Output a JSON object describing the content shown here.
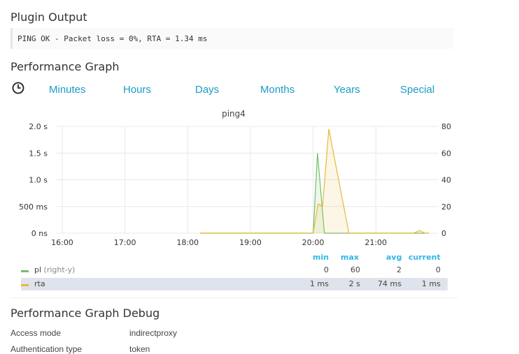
{
  "plugin_output": {
    "title": "Plugin Output",
    "text": "PING OK - Packet loss = 0%, RTA = 1.34 ms"
  },
  "performance_graph": {
    "title": "Performance Graph",
    "icon": "clock-icon",
    "ranges": [
      "Minutes",
      "Hours",
      "Days",
      "Months",
      "Years",
      "Special"
    ],
    "link_color": "#1a9bc7"
  },
  "chart_data": {
    "type": "area",
    "title": "ping4",
    "x_ticks": [
      "16:00",
      "17:00",
      "18:00",
      "19:00",
      "20:00",
      "21:00"
    ],
    "y_left_ticks": [
      "0 ns",
      "500 ms",
      "1.0 s",
      "1.5 s",
      "2.0 s"
    ],
    "y_right_ticks": [
      "0",
      "20",
      "40",
      "60",
      "80"
    ],
    "ylim_left_s": [
      0,
      2
    ],
    "ylim_right": [
      0,
      80
    ],
    "xlim_hours": [
      15.9,
      22.0
    ],
    "grid": true,
    "series": [
      {
        "name": "pl",
        "axis": "right-y",
        "color": "#73bf69",
        "points": [
          [
            18.2,
            0
          ],
          [
            20.0,
            0
          ],
          [
            20.07,
            60
          ],
          [
            20.18,
            0
          ],
          [
            21.0,
            0
          ],
          [
            21.85,
            0
          ]
        ]
      },
      {
        "name": "rta",
        "axis": "left-y",
        "unit": "s",
        "color": "#eab839",
        "points": [
          [
            18.2,
            0.001
          ],
          [
            20.0,
            0.001
          ],
          [
            20.08,
            0.55
          ],
          [
            20.15,
            0.5
          ],
          [
            20.25,
            1.95
          ],
          [
            20.57,
            0.001
          ],
          [
            21.6,
            0.001
          ],
          [
            21.7,
            0.05
          ],
          [
            21.78,
            0.001
          ],
          [
            21.85,
            0.001
          ]
        ]
      }
    ]
  },
  "legend": {
    "headers": {
      "min": "min",
      "max": "max",
      "avg": "avg",
      "current": "current"
    },
    "rows": [
      {
        "name": "pl",
        "suffix": "(right-y)",
        "min": "0",
        "max": "60",
        "avg": "2",
        "current": "0",
        "color": "#73bf69"
      },
      {
        "name": "rta",
        "suffix": "",
        "min": "1 ms",
        "max": "2 s",
        "avg": "74 ms",
        "current": "1 ms",
        "color": "#eab839"
      }
    ]
  },
  "debug": {
    "title": "Performance Graph Debug",
    "rows": [
      {
        "label": "Access mode",
        "value": "indirectproxy"
      },
      {
        "label": "Authentication type",
        "value": "token"
      }
    ]
  }
}
